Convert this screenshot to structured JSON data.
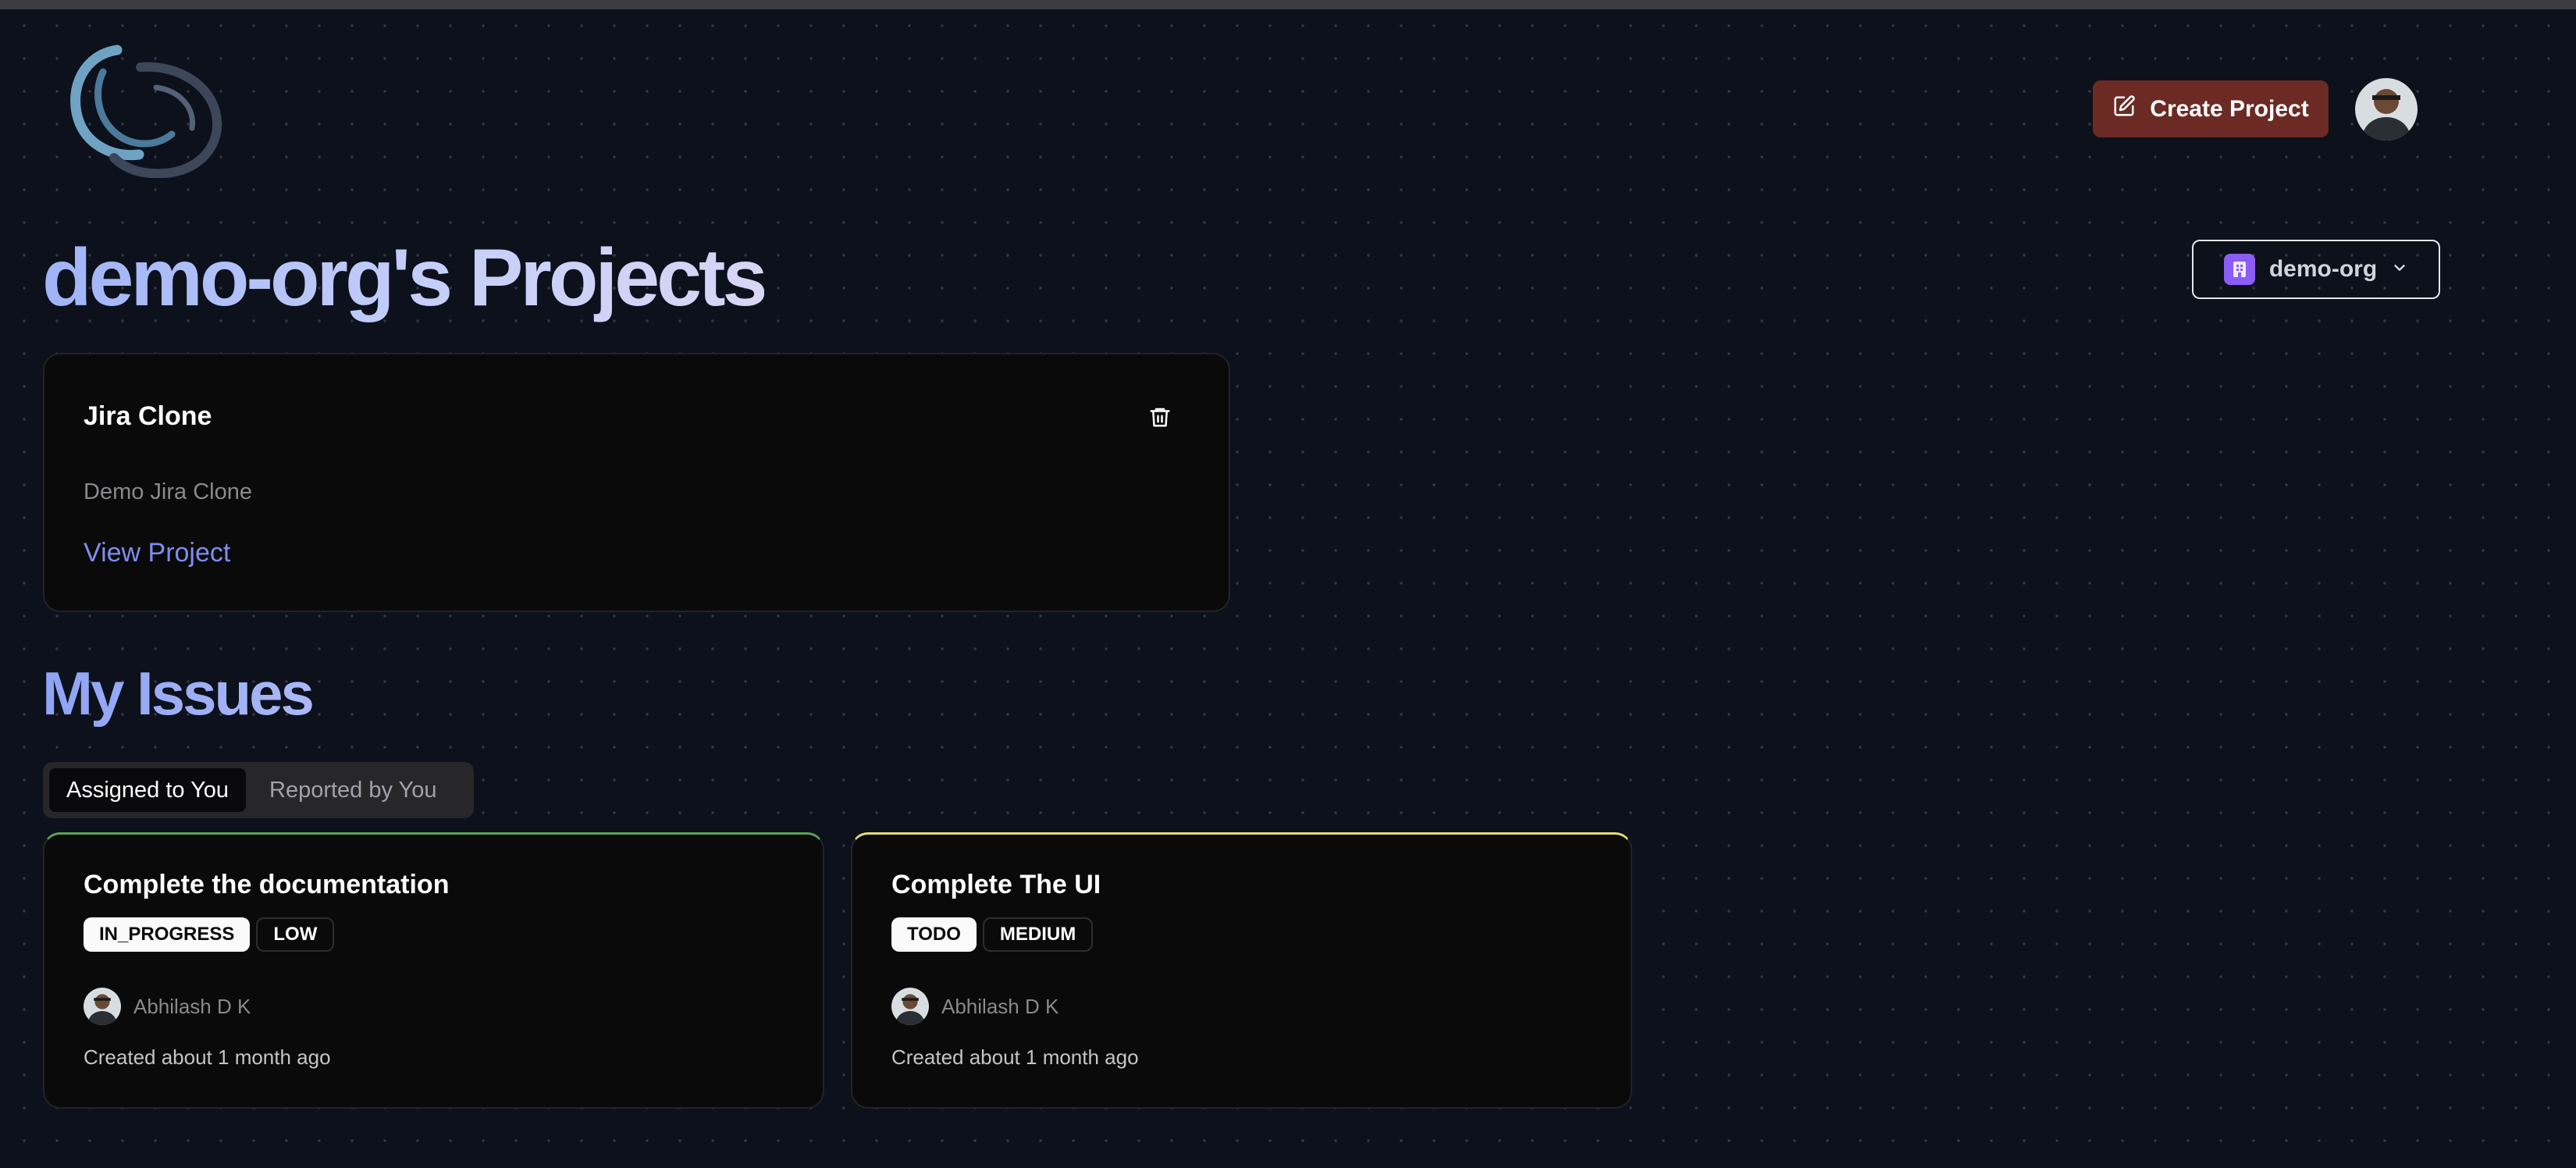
{
  "header": {
    "create_button_label": "Create Project"
  },
  "page": {
    "title": "demo-org's Projects"
  },
  "org_selector": {
    "selected": "demo-org"
  },
  "projects": [
    {
      "name": "Jira Clone",
      "description": "Demo Jira Clone",
      "link_label": "View Project"
    }
  ],
  "issues_section": {
    "title": "My Issues",
    "tabs": [
      {
        "label": "Assigned to You",
        "active": true
      },
      {
        "label": "Reported by You",
        "active": false
      }
    ],
    "items": [
      {
        "title": "Complete the documentation",
        "status": "IN_PROGRESS",
        "priority": "LOW",
        "assignee": "Abhilash D K",
        "created": "Created about 1 month ago",
        "accent_color": "#5aa351"
      },
      {
        "title": "Complete The UI",
        "status": "TODO",
        "priority": "MEDIUM",
        "assignee": "Abhilash D K",
        "created": "Created about 1 month ago",
        "accent_color": "#eadb72"
      }
    ]
  },
  "colors": {
    "background": "#0d111c",
    "create_button": "#6b2b24",
    "link": "#7f8df0",
    "org_icon": "#8b5cf6"
  },
  "icons": {
    "logo": "app-logo",
    "create": "edit-icon",
    "org": "building-icon",
    "dropdown": "chevron-down-icon",
    "delete": "trash-icon"
  }
}
